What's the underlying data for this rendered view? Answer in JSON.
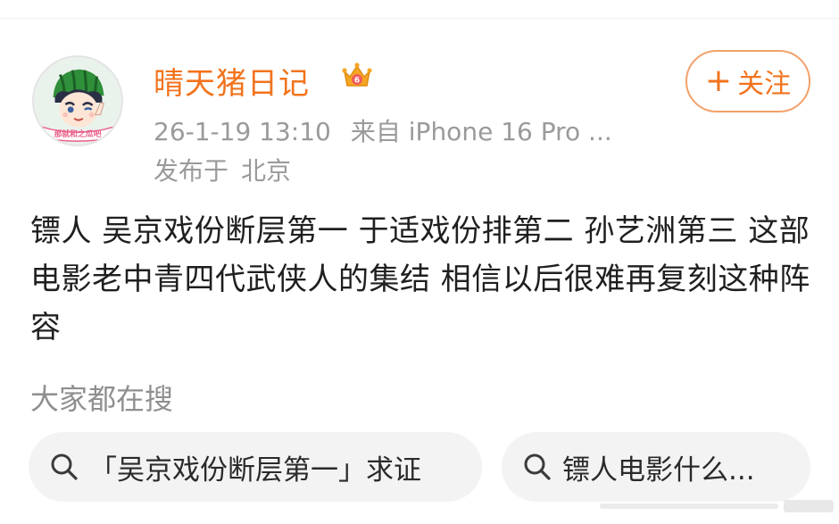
{
  "post": {
    "username": "晴天猪日记",
    "date": "26-1-19 13:10",
    "source": "来自 iPhone 16 Pro ...",
    "location_prefix": "发布于",
    "location": "北京",
    "follow_label": "关注",
    "text": "镖人 吴京戏份断层第一 于适戏份排第二 孙艺洲第三 这部电影老中青四代武侠人的集结 相信以后很难再复刻这种阵容"
  },
  "avatar": {
    "icon": "watermelon-cap-boy-avatar",
    "caption": "那就和之瓜吧"
  },
  "badges": {
    "vip_icon": "crown-vip-badge-icon"
  },
  "search_section": {
    "title": "大家都在搜",
    "chips": [
      {
        "label": "「吴京戏份断层第一」求证",
        "icon": "search-icon"
      },
      {
        "label": "镖人电影什么...",
        "icon": "search-icon"
      }
    ]
  },
  "colors": {
    "accent": "#f2731d",
    "meta": "#9a9a9a",
    "chip_bg": "#f3f3f3",
    "text": "#1f1f1f"
  }
}
